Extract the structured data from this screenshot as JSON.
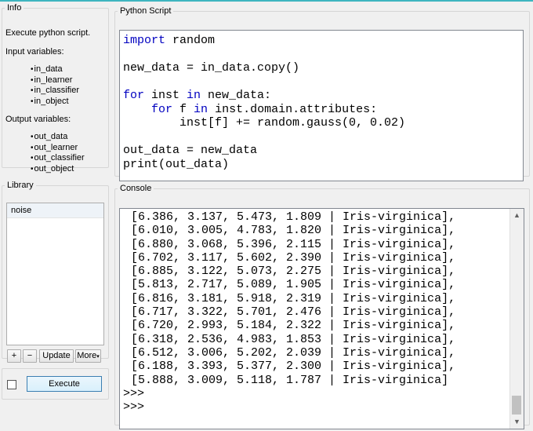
{
  "info": {
    "title": "Info",
    "description": "Execute python script.",
    "input_heading": "Input variables:",
    "inputs": [
      "in_data",
      "in_learner",
      "in_classifier",
      "in_object"
    ],
    "output_heading": "Output variables:",
    "outputs": [
      "out_data",
      "out_learner",
      "out_classifier",
      "out_object"
    ]
  },
  "library": {
    "title": "Library",
    "items": [
      "noise"
    ],
    "buttons": {
      "add": "+",
      "remove": "−",
      "update": "Update",
      "more": "More"
    }
  },
  "execute": {
    "label": "Execute",
    "auto_checked": false
  },
  "script": {
    "title": "Python Script",
    "lines": [
      [
        {
          "t": "import",
          "k": true
        },
        {
          "t": " random",
          "k": false
        }
      ],
      [],
      [
        {
          "t": "new_data = in_data.copy()",
          "k": false
        }
      ],
      [],
      [
        {
          "t": "for",
          "k": true
        },
        {
          "t": " inst ",
          "k": false
        },
        {
          "t": "in",
          "k": true
        },
        {
          "t": " new_data:",
          "k": false
        }
      ],
      [
        {
          "t": "    ",
          "k": false
        },
        {
          "t": "for",
          "k": true
        },
        {
          "t": " f ",
          "k": false
        },
        {
          "t": "in",
          "k": true
        },
        {
          "t": " inst.domain.attributes:",
          "k": false
        }
      ],
      [
        {
          "t": "        inst[f] += random.gauss(0, 0.02)",
          "k": false
        }
      ],
      [],
      [
        {
          "t": "out_data = new_data",
          "k": false
        }
      ],
      [
        {
          "t": "print(out_data)",
          "k": false
        }
      ]
    ]
  },
  "console": {
    "title": "Console",
    "lines": [
      "[6.386, 3.137, 5.473, 1.809 | Iris-virginica],",
      "[6.010, 3.005, 4.783, 1.820 | Iris-virginica],",
      "[6.880, 3.068, 5.396, 2.115 | Iris-virginica],",
      "[6.702, 3.117, 5.602, 2.390 | Iris-virginica],",
      "[6.885, 3.122, 5.073, 2.275 | Iris-virginica],",
      "[5.813, 2.717, 5.089, 1.905 | Iris-virginica],",
      "[6.816, 3.181, 5.918, 2.319 | Iris-virginica],",
      "[6.717, 3.322, 5.701, 2.476 | Iris-virginica],",
      "[6.720, 2.993, 5.184, 2.322 | Iris-virginica],",
      "[6.318, 2.536, 4.983, 1.853 | Iris-virginica],",
      "[6.512, 3.006, 5.202, 2.039 | Iris-virginica],",
      "[6.188, 3.393, 5.377, 2.300 | Iris-virginica],",
      "[5.888, 3.009, 5.118, 1.787 | Iris-virginica]"
    ],
    "prompts": [
      ">>>",
      ">>>"
    ]
  }
}
